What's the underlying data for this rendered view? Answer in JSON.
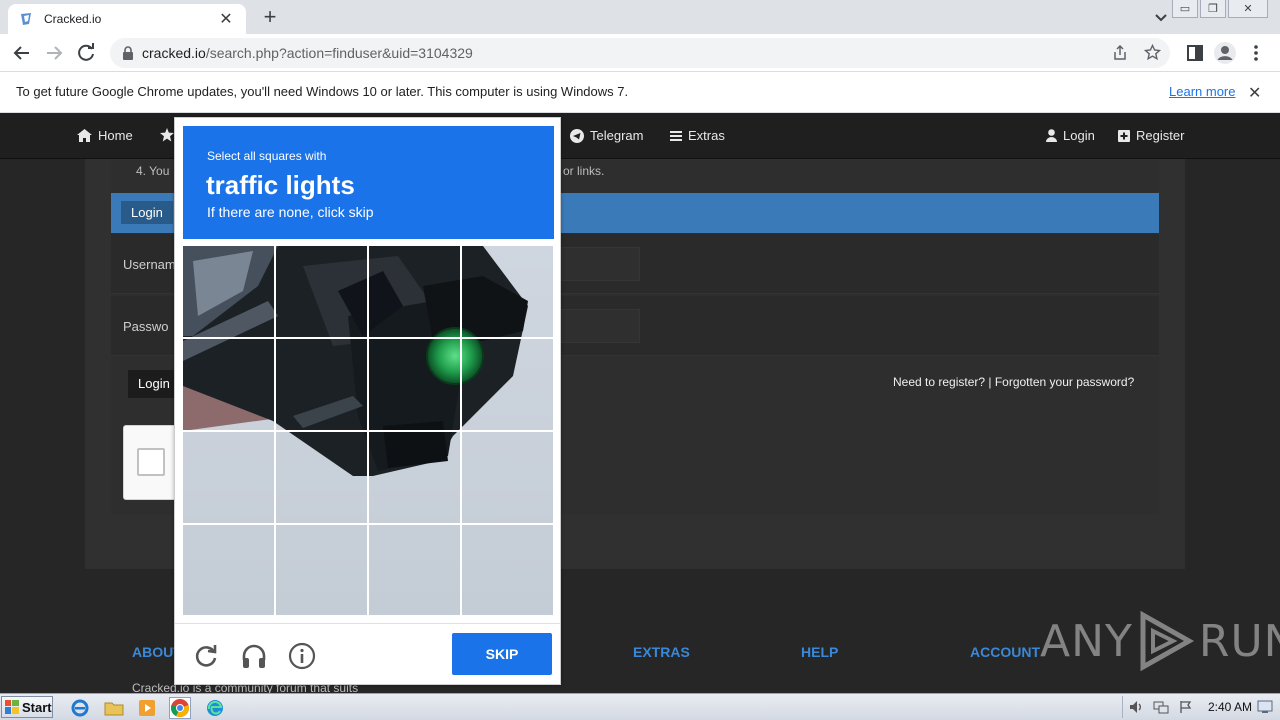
{
  "browser": {
    "tab_title": "Cracked.io",
    "url_host": "cracked.io",
    "url_path": "/search.php?action=finduser&uid=3104329"
  },
  "infobar": {
    "message": "To get future Google Chrome updates, you'll need Windows 10 or later. This computer is using Windows 7.",
    "link": "Learn more"
  },
  "site": {
    "nav": {
      "home": "Home",
      "telegram": "Telegram",
      "extras": "Extras",
      "login": "Login",
      "register": "Register"
    },
    "notice_left": "4. You",
    "notice_right": "or links.",
    "login_tab": "Login",
    "username_label": "Usernam",
    "password_label": "Passwo",
    "login_button": "Login",
    "register_links": "Need to register? | Forgotten your password?",
    "footer": {
      "about": "ABOUT",
      "extras": "EXTRAS",
      "help": "HELP",
      "account": "ACCOUNT",
      "about_text": "Cracked.io is a community forum that suits"
    }
  },
  "captcha": {
    "instruction": "Select all squares with",
    "target": "traffic lights",
    "hint": "If there are none, click skip",
    "skip_button": "SKIP",
    "grid_size": 4
  },
  "watermark": {
    "text_left": "ANY",
    "text_right": "RUN"
  },
  "taskbar": {
    "start": "Start",
    "clock": "2:40 AM"
  }
}
